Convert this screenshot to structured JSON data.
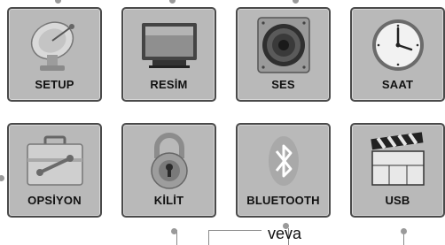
{
  "menu": {
    "items": [
      {
        "label": "SETUP",
        "icon": "satellite-dish-icon"
      },
      {
        "label": "RESİM",
        "icon": "tv-monitor-icon"
      },
      {
        "label": "SES",
        "icon": "speaker-icon"
      },
      {
        "label": "SAAT",
        "icon": "clock-icon"
      },
      {
        "label": "OPSİYON",
        "icon": "toolbox-icon"
      },
      {
        "label": "KİLİT",
        "icon": "padlock-icon"
      },
      {
        "label": "BLUETOOTH",
        "icon": "bluetooth-icon"
      },
      {
        "label": "USB",
        "icon": "clapperboard-icon"
      }
    ]
  },
  "annotation": {
    "text": "veva"
  }
}
